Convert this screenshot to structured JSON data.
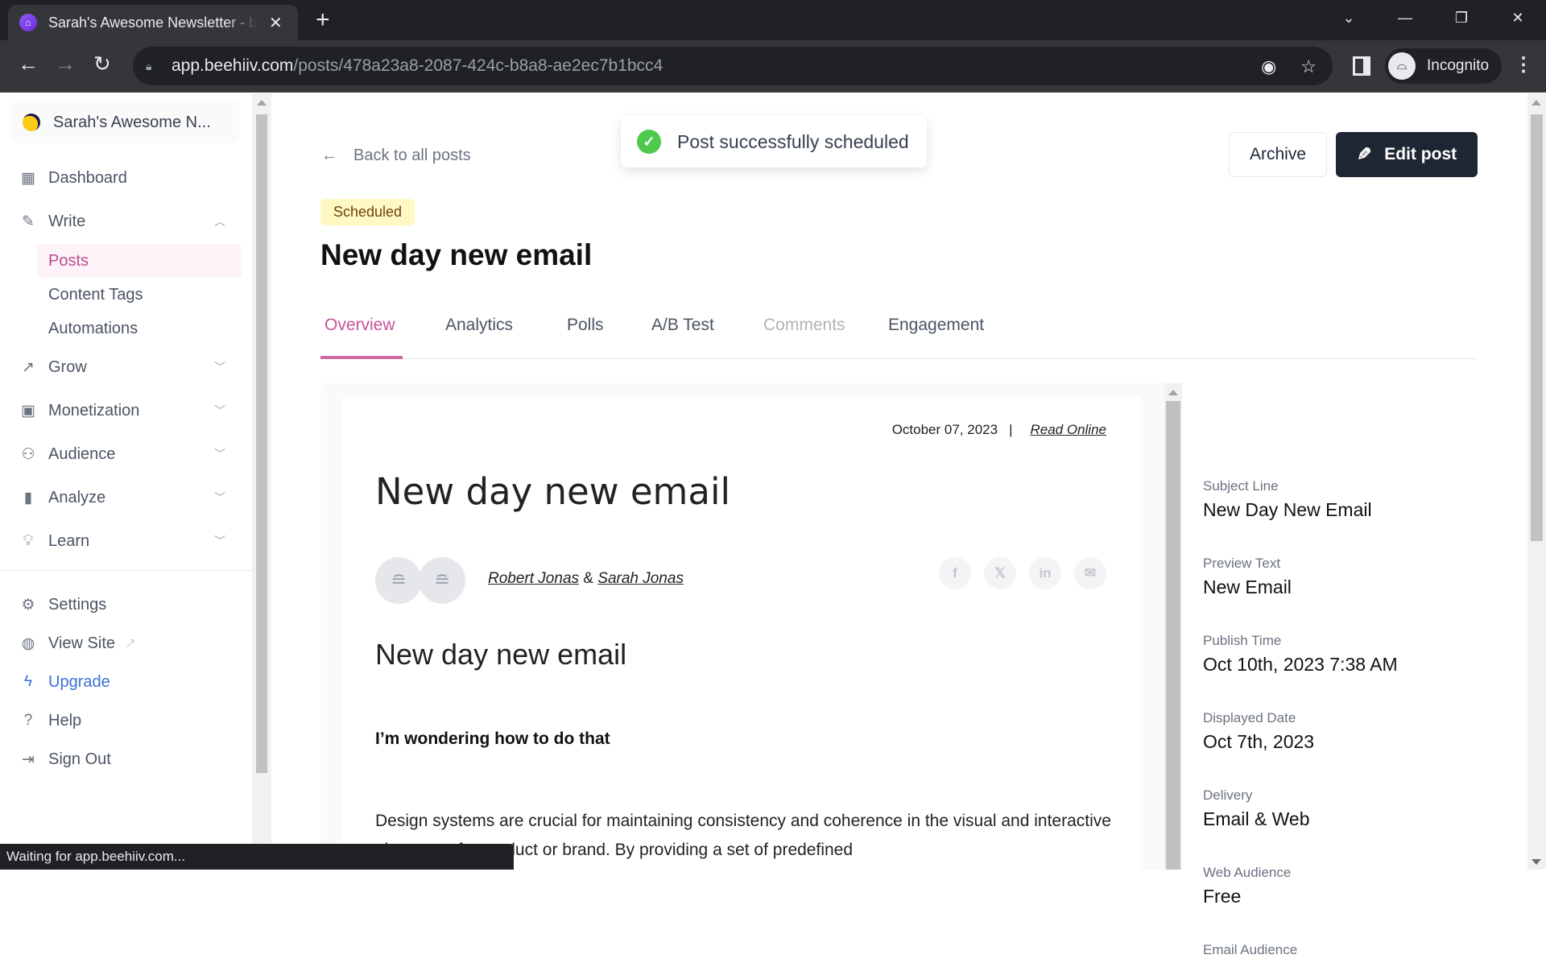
{
  "browser": {
    "tab_title": "Sarah's Awesome Newsletter - beehiiv",
    "url_host": "app.beehiiv.com",
    "url_path": "/posts/478a23a8-2087-424c-b8a8-ae2ec7b1bcc4",
    "profile_label": "Incognito",
    "status_text": "Waiting for app.beehiiv.com..."
  },
  "sidebar": {
    "publication_name": "Sarah's Awesome N...",
    "items": [
      {
        "label": "Dashboard",
        "icon": "grid-icon"
      },
      {
        "label": "Write",
        "icon": "pencil-icon",
        "expanded": true
      },
      {
        "label": "Grow",
        "icon": "trending-up-icon"
      },
      {
        "label": "Monetization",
        "icon": "cash-icon"
      },
      {
        "label": "Audience",
        "icon": "users-icon"
      },
      {
        "label": "Analyze",
        "icon": "bar-chart-icon"
      },
      {
        "label": "Learn",
        "icon": "lightbulb-icon"
      }
    ],
    "write_subitems": [
      {
        "label": "Posts",
        "active": true
      },
      {
        "label": "Content Tags"
      },
      {
        "label": "Automations"
      }
    ],
    "bottom_items": [
      {
        "label": "Settings",
        "icon": "gear-icon"
      },
      {
        "label": "View Site",
        "icon": "globe-icon"
      },
      {
        "label": "Upgrade",
        "icon": "lightning-icon"
      },
      {
        "label": "Help",
        "icon": "help-icon"
      },
      {
        "label": "Sign Out",
        "icon": "sign-out-icon"
      }
    ]
  },
  "header": {
    "back_label": "Back to all posts",
    "toast_message": "Post successfully scheduled",
    "archive_label": "Archive",
    "edit_label": "Edit post",
    "status_badge": "Scheduled",
    "title": "New day new email"
  },
  "tabs": [
    {
      "label": "Overview",
      "active": true
    },
    {
      "label": "Analytics"
    },
    {
      "label": "Polls"
    },
    {
      "label": "A/B Test"
    },
    {
      "label": "Comments",
      "disabled": true
    },
    {
      "label": "Engagement"
    }
  ],
  "preview": {
    "date": "October 07, 2023",
    "separator": "|",
    "read_online": "Read Online",
    "title": "New day new email",
    "author_1": "Robert Jonas",
    "author_joiner": "&",
    "author_2": "Sarah Jonas",
    "share_icons": [
      "f",
      "𝕏",
      "in",
      "✉"
    ],
    "heading": "New day new email",
    "subheading": "I’m wondering how to do that",
    "body": "Design systems are crucial for maintaining consistency and coherence in the visual and interactive elements of a product or brand. By providing a set of predefined"
  },
  "details": [
    {
      "label": "Subject Line",
      "value": "New Day New Email"
    },
    {
      "label": "Preview Text",
      "value": "New Email"
    },
    {
      "label": "Publish Time",
      "value": "Oct 10th, 2023 7:38 AM"
    },
    {
      "label": "Displayed Date",
      "value": "Oct 7th, 2023"
    },
    {
      "label": "Delivery",
      "value": "Email & Web"
    },
    {
      "label": "Web Audience",
      "value": "Free"
    },
    {
      "label": "Email Audience",
      "value": ""
    }
  ]
}
